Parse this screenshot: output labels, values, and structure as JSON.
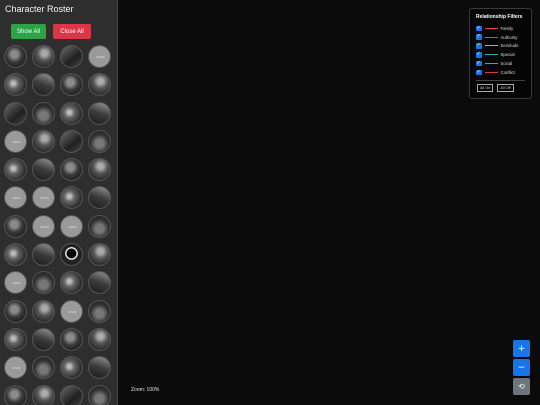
{
  "sidebar": {
    "title": "Character Roster",
    "show_all_label": "Show All",
    "close_all_label": "Close All",
    "avatars": [
      "photo",
      "photo",
      "photo",
      "placeholder",
      "photo",
      "photo",
      "photo",
      "photo",
      "photo",
      "photo",
      "photo",
      "photo",
      "placeholder",
      "photo",
      "photo",
      "photo",
      "photo",
      "photo",
      "photo",
      "photo",
      "placeholder",
      "placeholder",
      "photo",
      "photo",
      "photo",
      "placeholder",
      "placeholder",
      "photo",
      "photo",
      "photo",
      "dark",
      "photo",
      "placeholder",
      "photo",
      "photo",
      "photo",
      "photo",
      "photo",
      "placeholder",
      "photo",
      "photo",
      "photo",
      "photo",
      "photo",
      "placeholder",
      "photo",
      "photo",
      "photo",
      "photo",
      "photo",
      "photo",
      "photo"
    ]
  },
  "filters": {
    "title": "Relationship Filters",
    "items": [
      {
        "label": "Family",
        "color": "#e8453c",
        "checked": true
      },
      {
        "label": "Authority",
        "color": "#7b5cd6",
        "checked": true
      },
      {
        "label": "Servitude",
        "color": "#e0a43a",
        "checked": true
      },
      {
        "label": "Special",
        "color": "#2bb5a8",
        "checked": true
      },
      {
        "label": "Social",
        "color": "#4caf50",
        "checked": true
      },
      {
        "label": "Conflict",
        "color": "#d93a3a",
        "checked": true
      }
    ],
    "all_on_label": "All On",
    "all_off_label": "All Off"
  },
  "zoom": {
    "label": "Zoom: 100%",
    "in_symbol": "+",
    "out_symbol": "−",
    "reset_symbol": "⟲"
  }
}
